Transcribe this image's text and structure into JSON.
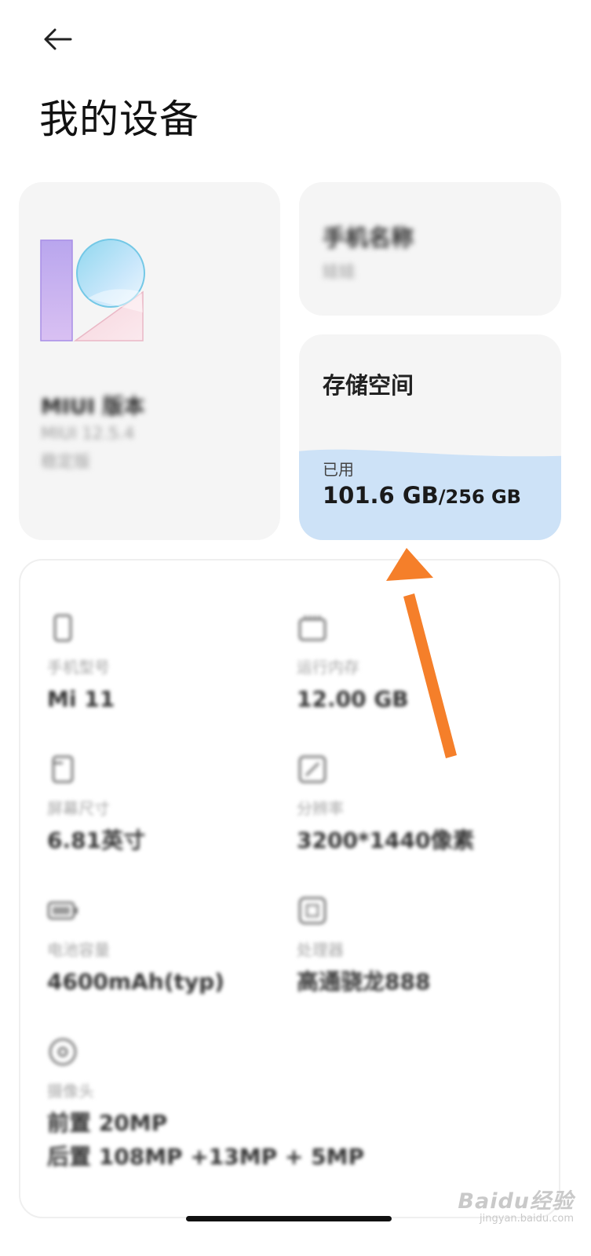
{
  "header": {
    "title": "我的设备"
  },
  "miui_card": {
    "title": "MIUI 版本",
    "version": "MIUI 12.5.4",
    "channel": "稳定版"
  },
  "name_card": {
    "title": "手机名称",
    "value": "娃娃"
  },
  "storage_card": {
    "title": "存储空间",
    "used_label": "已用",
    "used": "101.6 GB",
    "total": "/256 GB",
    "used_fraction": 0.397,
    "fill_color": "#cde2f7"
  },
  "specs": [
    {
      "icon": "phone-icon",
      "label": "手机型号",
      "value": "Mi 11"
    },
    {
      "icon": "memory-chip-icon",
      "label": "运行内存",
      "value": "12.00 GB"
    },
    {
      "icon": "screen-size-icon",
      "label": "屏幕尺寸",
      "value": "6.81英寸"
    },
    {
      "icon": "resolution-icon",
      "label": "分辨率",
      "value": "3200*1440像素"
    },
    {
      "icon": "battery-icon",
      "label": "电池容量",
      "value": "4600mAh(typ)"
    },
    {
      "icon": "processor-icon",
      "label": "处理器",
      "value": "高通骁龙888"
    },
    {
      "icon": "camera-icon",
      "label": "摄像头",
      "value": "前置 20MP",
      "value2": "后置 108MP +13MP + 5MP"
    }
  ],
  "annotation": {
    "color": "#f57f2a"
  },
  "watermark": {
    "brand": "Baidu经验",
    "url": "jingyan.baidu.com"
  }
}
